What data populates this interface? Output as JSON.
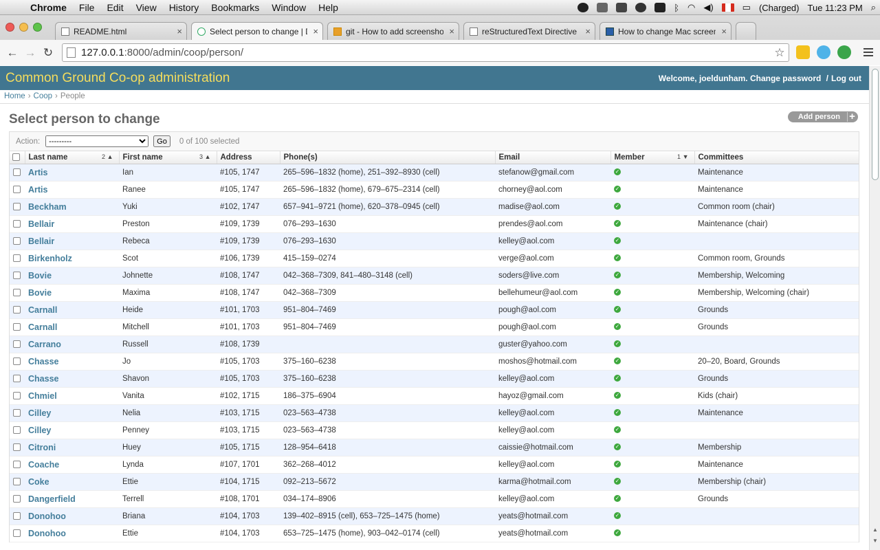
{
  "menubar": {
    "app": "Chrome",
    "items": [
      "File",
      "Edit",
      "View",
      "History",
      "Bookmarks",
      "Window",
      "Help"
    ],
    "battery": "(Charged)",
    "clock": "Tue 11:23 PM"
  },
  "tabs": [
    {
      "label": "README.html",
      "active": false
    },
    {
      "label": "Select person to change | D",
      "active": true
    },
    {
      "label": "git - How to add screensho",
      "active": false
    },
    {
      "label": "reStructuredText Directive",
      "active": false
    },
    {
      "label": "How to change Mac screen",
      "active": false
    }
  ],
  "address": {
    "host": "127.0.0.1",
    "rest": ":8000/admin/coop/person/"
  },
  "header": {
    "branding": "Common Ground Co-op administration",
    "welcome": "Welcome, ",
    "user": "joeldunham",
    "dot": ".",
    "change_password": "Change password",
    "slash": "/",
    "logout": "Log out"
  },
  "breadcrumbs": {
    "home": "Home",
    "sep1": "›",
    "coop": "Coop",
    "sep2": "›",
    "current": "People"
  },
  "page": {
    "title": "Select person to change",
    "add_label": "Add person"
  },
  "actions": {
    "label": "Action:",
    "select_value": "---------",
    "go": "Go",
    "count": "0 of 100 selected"
  },
  "columns": {
    "last": "Last name",
    "last_order": "2",
    "first": "First name",
    "first_order": "3",
    "address": "Address",
    "phone": "Phone(s)",
    "email": "Email",
    "member": "Member",
    "member_order": "1",
    "committees": "Committees"
  },
  "rows": [
    {
      "last": "Artis",
      "first": "Ian",
      "address": "#105, 1747",
      "phone": "265–596–1832 (home), 251–392–8930 (cell)",
      "email": "stefanow@gmail.com",
      "committees": "Maintenance"
    },
    {
      "last": "Artis",
      "first": "Ranee",
      "address": "#105, 1747",
      "phone": "265–596–1832 (home), 679–675–2314 (cell)",
      "email": "chorney@aol.com",
      "committees": "Maintenance"
    },
    {
      "last": "Beckham",
      "first": "Yuki",
      "address": "#102, 1747",
      "phone": "657–941–9721 (home), 620–378–0945 (cell)",
      "email": "madise@aol.com",
      "committees": "Common room (chair)"
    },
    {
      "last": "Bellair",
      "first": "Preston",
      "address": "#109, 1739",
      "phone": "076–293–1630",
      "email": "prendes@aol.com",
      "committees": "Maintenance (chair)"
    },
    {
      "last": "Bellair",
      "first": "Rebeca",
      "address": "#109, 1739",
      "phone": "076–293–1630",
      "email": "kelley@aol.com",
      "committees": ""
    },
    {
      "last": "Birkenholz",
      "first": "Scot",
      "address": "#106, 1739",
      "phone": "415–159–0274",
      "email": "verge@aol.com",
      "committees": "Common room, Grounds"
    },
    {
      "last": "Bovie",
      "first": "Johnette",
      "address": "#108, 1747",
      "phone": "042–368–7309, 841–480–3148 (cell)",
      "email": "soders@live.com",
      "committees": "Membership, Welcoming"
    },
    {
      "last": "Bovie",
      "first": "Maxima",
      "address": "#108, 1747",
      "phone": "042–368–7309",
      "email": "bellehumeur@aol.com",
      "committees": "Membership, Welcoming (chair)"
    },
    {
      "last": "Carnall",
      "first": "Heide",
      "address": "#101, 1703",
      "phone": "951–804–7469",
      "email": "pough@aol.com",
      "committees": "Grounds"
    },
    {
      "last": "Carnall",
      "first": "Mitchell",
      "address": "#101, 1703",
      "phone": "951–804–7469",
      "email": "pough@aol.com",
      "committees": "Grounds"
    },
    {
      "last": "Carrano",
      "first": "Russell",
      "address": "#108, 1739",
      "phone": "",
      "email": "guster@yahoo.com",
      "committees": ""
    },
    {
      "last": "Chasse",
      "first": "Jo",
      "address": "#105, 1703",
      "phone": "375–160–6238",
      "email": "moshos@hotmail.com",
      "committees": "20–20, Board, Grounds"
    },
    {
      "last": "Chasse",
      "first": "Shavon",
      "address": "#105, 1703",
      "phone": "375–160–6238",
      "email": "kelley@aol.com",
      "committees": "Grounds"
    },
    {
      "last": "Chmiel",
      "first": "Vanita",
      "address": "#102, 1715",
      "phone": "186–375–6904",
      "email": "hayoz@gmail.com",
      "committees": "Kids (chair)"
    },
    {
      "last": "Cilley",
      "first": "Nelia",
      "address": "#103, 1715",
      "phone": "023–563–4738",
      "email": "kelley@aol.com",
      "committees": "Maintenance"
    },
    {
      "last": "Cilley",
      "first": "Penney",
      "address": "#103, 1715",
      "phone": "023–563–4738",
      "email": "kelley@aol.com",
      "committees": ""
    },
    {
      "last": "Citroni",
      "first": "Huey",
      "address": "#105, 1715",
      "phone": "128–954–6418",
      "email": "caissie@hotmail.com",
      "committees": "Membership"
    },
    {
      "last": "Coache",
      "first": "Lynda",
      "address": "#107, 1701",
      "phone": "362–268–4012",
      "email": "kelley@aol.com",
      "committees": "Maintenance"
    },
    {
      "last": "Coke",
      "first": "Ettie",
      "address": "#104, 1715",
      "phone": "092–213–5672",
      "email": "karma@hotmail.com",
      "committees": "Membership (chair)"
    },
    {
      "last": "Dangerfield",
      "first": "Terrell",
      "address": "#108, 1701",
      "phone": "034–174–8906",
      "email": "kelley@aol.com",
      "committees": "Grounds"
    },
    {
      "last": "Donohoo",
      "first": "Briana",
      "address": "#104, 1703",
      "phone": "139–402–8915 (cell), 653–725–1475 (home)",
      "email": "yeats@hotmail.com",
      "committees": ""
    },
    {
      "last": "Donohoo",
      "first": "Ettie",
      "address": "#104, 1703",
      "phone": "653–725–1475 (home), 903–042–0174 (cell)",
      "email": "yeats@hotmail.com",
      "committees": ""
    }
  ],
  "colors": {
    "header_bg": "#417690",
    "branding": "#f5dd5d",
    "link": "#447e9b",
    "row_alt": "#edf3fe",
    "member_yes": "#3ea83e"
  }
}
